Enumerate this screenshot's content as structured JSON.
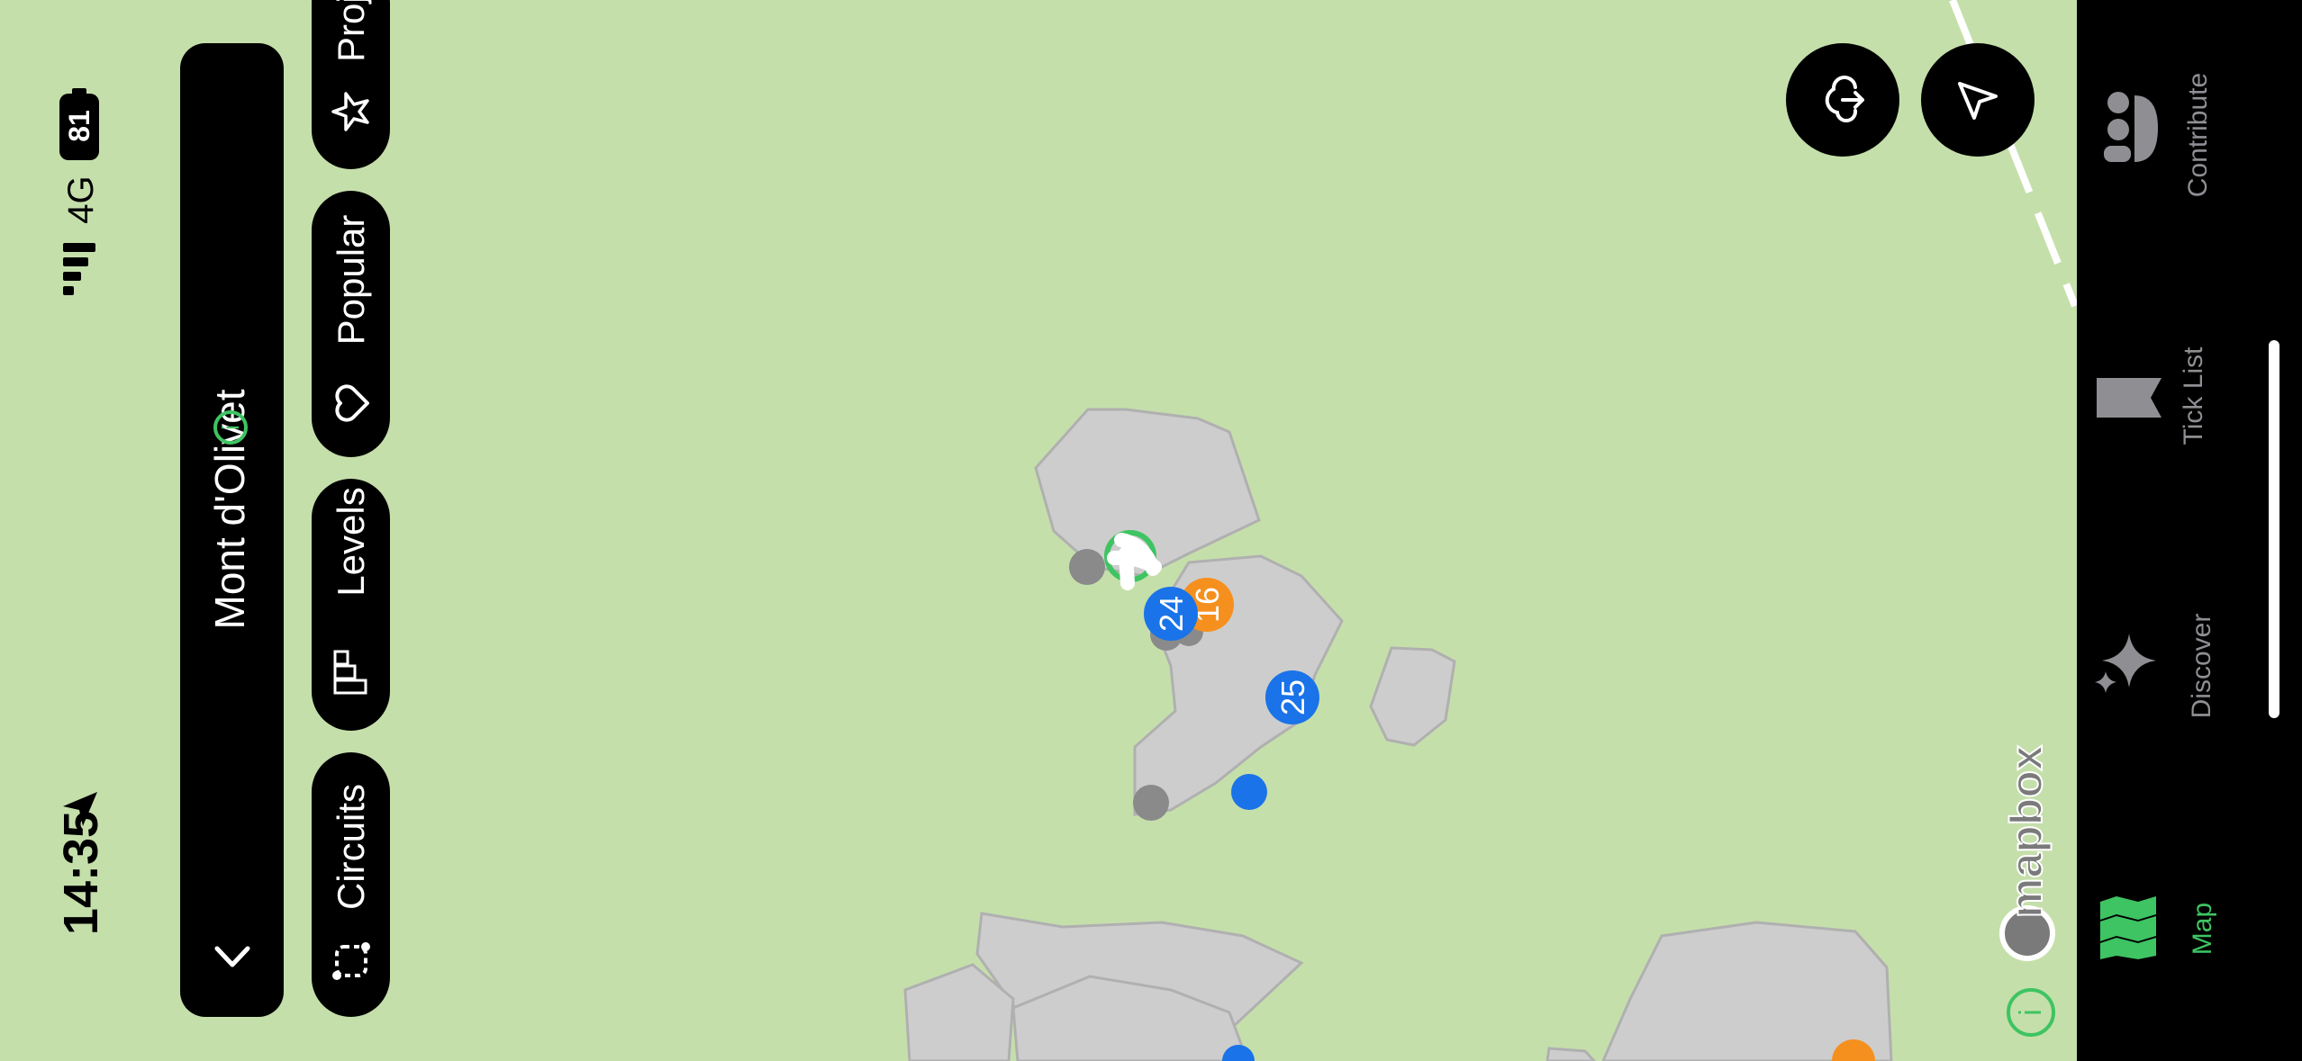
{
  "status_bar": {
    "time": "14:35",
    "network": "4G",
    "battery": "81"
  },
  "area": {
    "name": "Mont d'Olivet"
  },
  "filters": [
    {
      "label": "Circuits",
      "icon": "circuit-icon"
    },
    {
      "label": "Levels",
      "icon": "bar-chart-icon"
    },
    {
      "label": "Popular",
      "icon": "heart-icon"
    },
    {
      "label": "Proj",
      "icon": "star-icon"
    }
  ],
  "map": {
    "attribution": "mapbox",
    "markers": [
      {
        "label": "24",
        "color": "#1a73e8"
      },
      {
        "label": "16",
        "color": "#f5901e"
      },
      {
        "label": "25",
        "color": "#1a73e8"
      }
    ]
  },
  "tabs": [
    {
      "label": "Map",
      "icon": "map-icon",
      "active": true
    },
    {
      "label": "Discover",
      "icon": "sparkle-icon",
      "active": false
    },
    {
      "label": "Tick List",
      "icon": "flag-icon",
      "active": false
    },
    {
      "label": "Contribute",
      "icon": "people-icon",
      "active": false
    }
  ],
  "colors": {
    "accent": "#3ec462",
    "map_bg": "#c5dfab",
    "boulder": "#cdcdcd"
  }
}
